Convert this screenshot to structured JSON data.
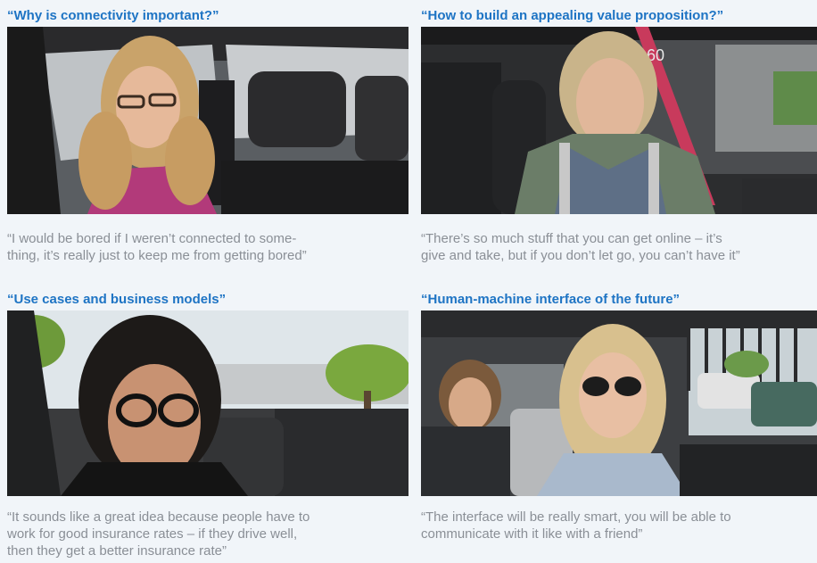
{
  "panels": [
    {
      "heading": "“Why is connectivity important?”",
      "quote_lines": [
        "“I would be bored if I weren’t connected to some-",
        "thing, it’s really just to keep me from getting bored”"
      ]
    },
    {
      "heading": "“How to build an appealing value proposition?”",
      "quote_lines": [
        "“There’s so much stuff that you can get online – it’s",
        "give and take, but if you don’t let go, you can’t have it”"
      ]
    },
    {
      "heading": "“Use cases and business models”",
      "quote_lines": [
        "“It sounds like a great idea because people have to",
        "work for good insurance rates – if they drive well,",
        "then they get a better insurance rate”"
      ]
    },
    {
      "heading": "“Human-machine interface of the future”",
      "quote_lines": [
        "“The interface will be really smart, you will be able to",
        "communicate with it like with a friend”"
      ]
    }
  ],
  "colors": {
    "heading": "#1e74c4",
    "quote": "#8a8f96",
    "background": "#f1f5f9"
  },
  "photo_signs": {
    "panel2_number": "60"
  }
}
